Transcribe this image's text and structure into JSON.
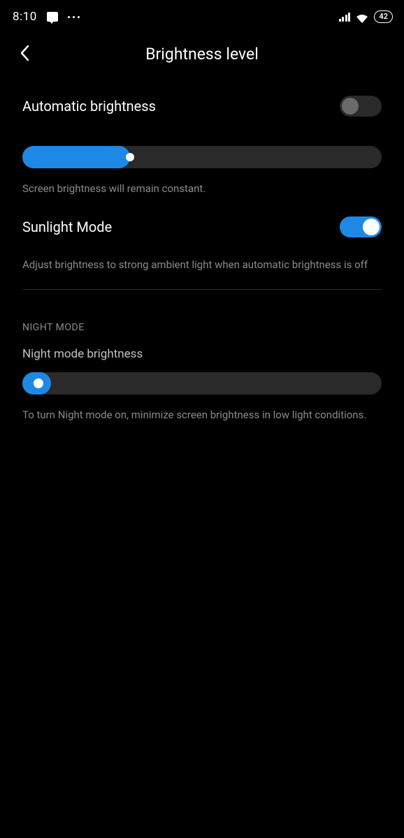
{
  "statusBar": {
    "time": "8:10",
    "battery": "42"
  },
  "header": {
    "title": "Brightness level"
  },
  "autoBrightness": {
    "label": "Automatic brightness",
    "description": "Screen brightness will remain constant."
  },
  "sunlightMode": {
    "label": "Sunlight Mode",
    "description": "Adjust brightness to strong ambient light when automatic brightness is off"
  },
  "nightMode": {
    "sectionTitle": "NIGHT MODE",
    "label": "Night mode brightness",
    "description": "To turn Night mode on, minimize screen brightness in low light conditions."
  }
}
